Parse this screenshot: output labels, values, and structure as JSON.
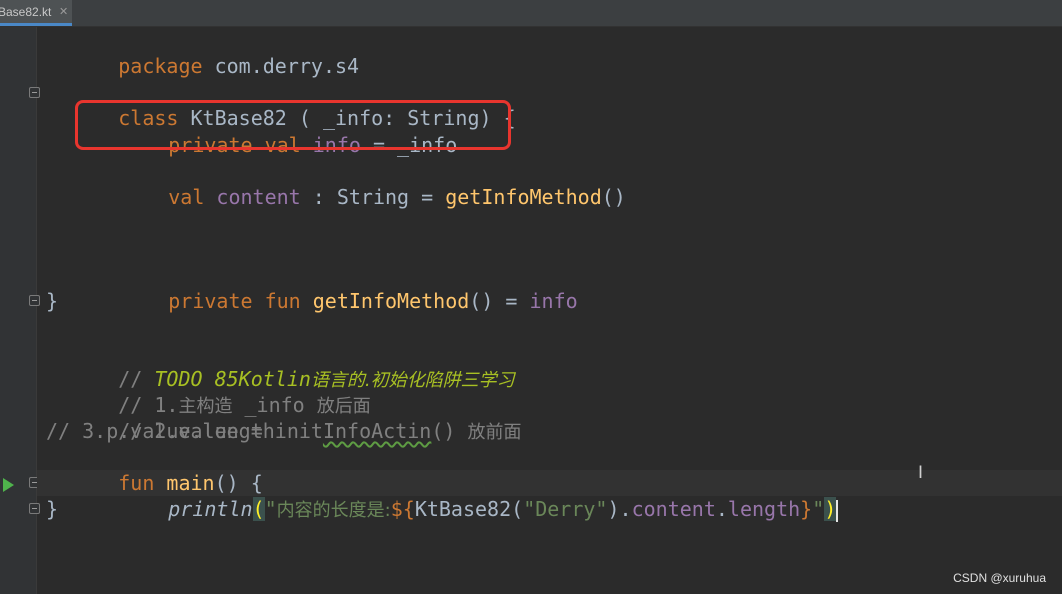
{
  "tab": {
    "label": "Base82.kt",
    "close": "✕"
  },
  "code": {
    "l1": {
      "kw": "package",
      "rest": " com.derry.s4"
    },
    "l3": {
      "kw": "class",
      "name": " KtBase82 ( _info: String) {"
    },
    "l4": {
      "priv": "private",
      "val": " val",
      "prop": " info",
      "rest": " = _info"
    },
    "l6": {
      "val": "val",
      "prop": " content",
      "rest1": " : String = ",
      "fn": "getInfoMethod",
      "rest2": "()"
    },
    "l10": {
      "priv": "private",
      "fun": " fun",
      "fn": " getInfoMethod",
      "rest": "() = ",
      "prop": "info"
    },
    "l11": "}",
    "l13": {
      "slashes": "// ",
      "todo": "TODO 85Kotlin",
      "todo_cn": "语言的.初始化陷阱三学习"
    },
    "l14": {
      "a": "// 1.",
      "cn1": "主构造",
      "b": " _info ",
      "cn2": "放后面"
    },
    "l15": {
      "a": "// 2.value = init",
      "sq": "InfoActin",
      "b": "() ",
      "cn": "放前面"
    },
    "l16": "// 3.p.value.length",
    "l17": {
      "fun": "fun",
      "fn": " main",
      "rest": "() {"
    },
    "l18": {
      "println": "println",
      "open": "(",
      "q1": "\"",
      "cn": "内容的长度是:",
      "tmpl": "${",
      "call": "KtBase82(",
      "arg": "\"Derry\"",
      "dot": ").",
      "p1": "content",
      "dot2": ".",
      "p2": "length",
      "close_tmpl": "}",
      "q2": "\"",
      "close": ")"
    },
    "l19": "}"
  },
  "watermark": "CSDN @xuruhua",
  "colors": {
    "keyword": "#cc7832",
    "property": "#9876aa",
    "function": "#ffc66d",
    "string": "#6a8759",
    "comment": "#808080",
    "todo": "#a8c023",
    "highlight_box": "#e8352e"
  },
  "icons": {
    "run": "run-gutter-icon",
    "fold": "fold-marker-icon",
    "cursor": "text-cursor-icon"
  }
}
